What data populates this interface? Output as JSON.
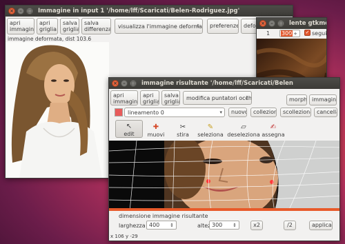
{
  "input_window": {
    "title": "Immagine in input 1 '/home/lff/Scaricati/Belen-Rodriguez.jpg'",
    "toolbar": {
      "open_image": "apri\nimmagine",
      "open_grid": "apri\ngriglia",
      "save_grid": "salva\ngriglia",
      "save_difference": "salva\ndifferenza",
      "view_combo": "visualizza l'immagine deformata",
      "preferences": "preferenze",
      "deform_partial": "deform"
    },
    "status": "immagine deformata, dist 103.6"
  },
  "lens_window": {
    "title": "lente gtkmor",
    "zoom_value": "1",
    "size_value": "300",
    "follow_label": "segui",
    "follow_checked": true
  },
  "result_window": {
    "title": "immagine risultante '/home/lff/Scaricati/Belen",
    "toolbar": {
      "open_image": "apri\nimmagine",
      "open_grid": "apri\ngriglia",
      "save_grid": "salva\ngriglia",
      "mode_combo": "modifica puntatori occhi",
      "morph": "morph",
      "image": "immagine"
    },
    "feature_row": {
      "color": "#e85b5b",
      "feature_combo": "lineamento 0",
      "new": "nuovo",
      "link": "colleziona",
      "unlink": "scolleziona",
      "delete": "cancella"
    },
    "tools": [
      {
        "label": "edit",
        "icon": "edit-cursor-icon",
        "glyph": "↖"
      },
      {
        "label": "muovi",
        "icon": "move-icon",
        "glyph": "✚"
      },
      {
        "label": "stira",
        "icon": "stretch-icon",
        "glyph": "✂"
      },
      {
        "label": "seleziona",
        "icon": "select-icon",
        "glyph": "✎"
      },
      {
        "label": "deseleziona",
        "icon": "deselect-eraser-icon",
        "glyph": "▱"
      },
      {
        "label": "assegna",
        "icon": "assign-icon",
        "glyph": "✍"
      }
    ],
    "size_section": {
      "heading": "dimensione immagine risultante",
      "width_label": "larghezza",
      "width_value": "400",
      "height_label": "altezza",
      "height_value": "300",
      "x2": "x2",
      "div2": "/2",
      "apply": "applica"
    },
    "coords": "x 106 y -29"
  },
  "colors": {
    "titlebar": "#3c3b37",
    "close_button": "#e6643c",
    "accent_orange": "#e3592e",
    "window_bg": "#f2f1f0"
  }
}
